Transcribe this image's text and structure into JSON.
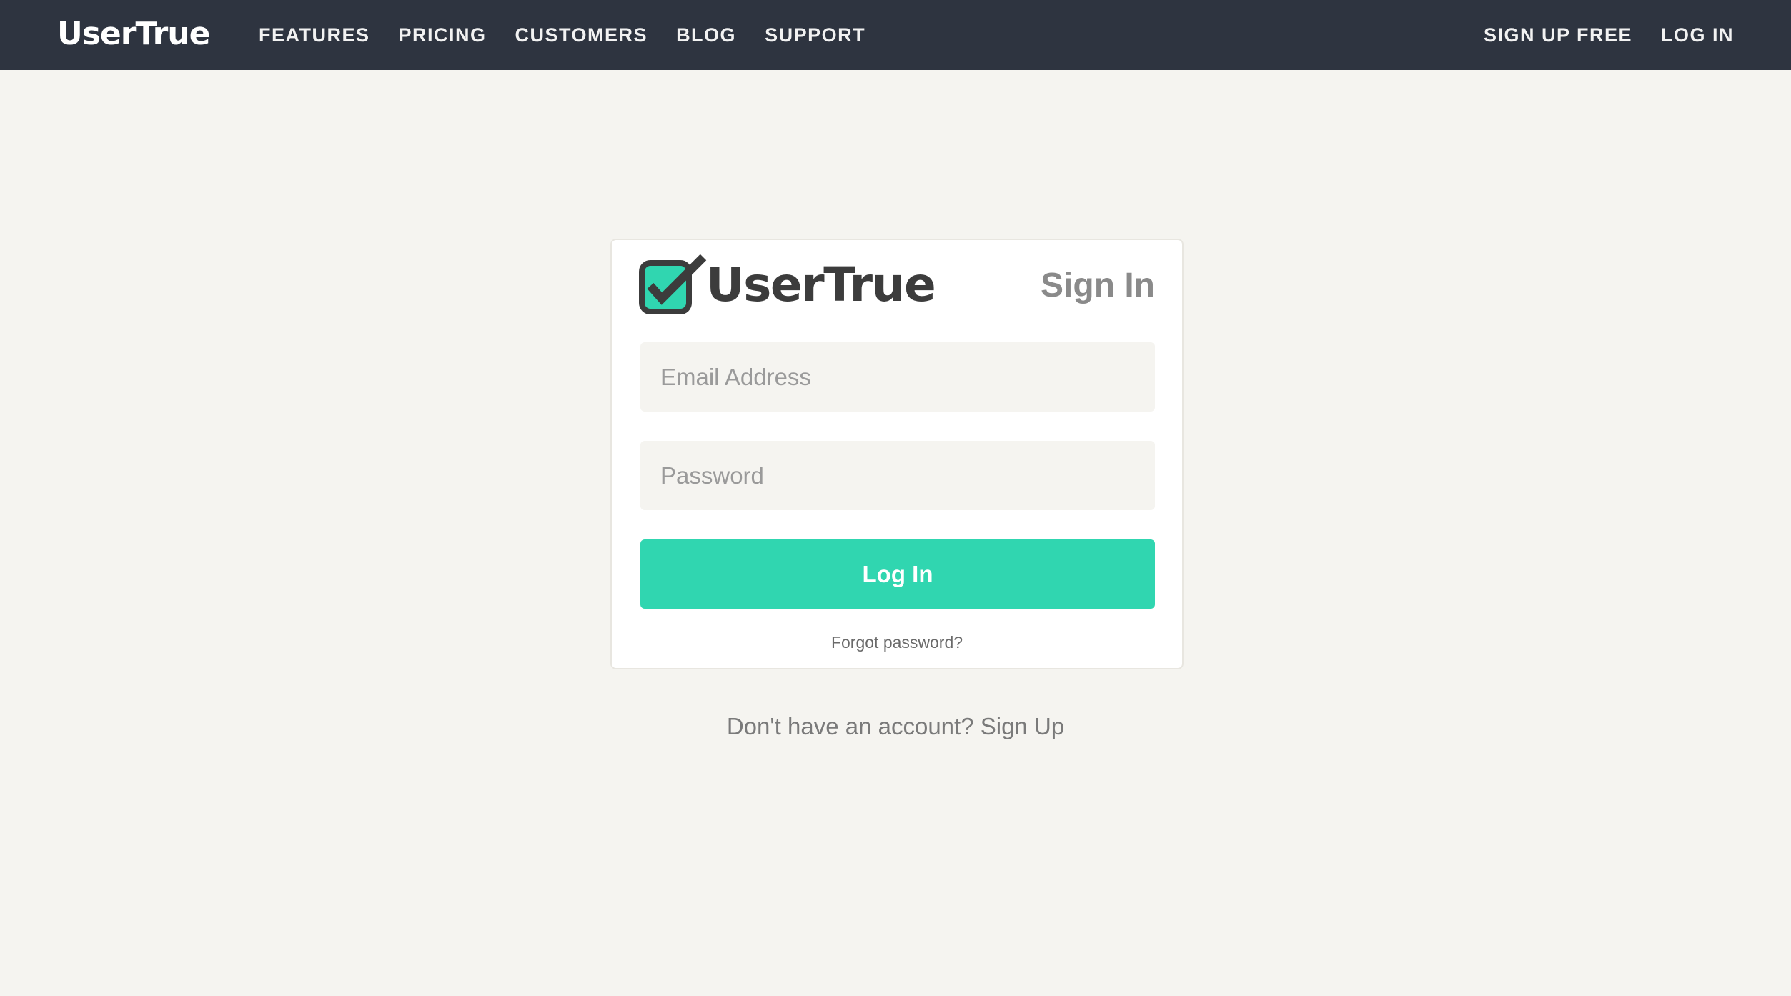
{
  "nav": {
    "brand": "UserTrue",
    "links": [
      "FEATURES",
      "PRICING",
      "CUSTOMERS",
      "BLOG",
      "SUPPORT"
    ],
    "signup": "SIGN UP FREE",
    "login": "LOG IN"
  },
  "card": {
    "logo_text": "UserTrue",
    "title": "Sign In",
    "email_placeholder": "Email Address",
    "password_placeholder": "Password",
    "login_button": "Log In",
    "forgot": "Forgot password?"
  },
  "footer": {
    "prompt": "Don't have an account?",
    "signup_link": "Sign Up"
  },
  "colors": {
    "topbar": "#2e3440",
    "accent": "#30d6b0",
    "background": "#f5f4f0",
    "logo_dark": "#3c3c3c"
  }
}
